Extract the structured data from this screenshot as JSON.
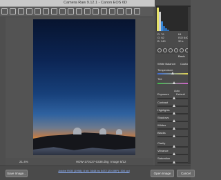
{
  "window": {
    "title": "Camera Raw 9.12.1  -  Canon EOS 6D"
  },
  "toolbar": {
    "tools": [
      "zoom-icon",
      "hand-icon",
      "white-balance-icon",
      "color-sampler-icon",
      "targeted-adjustment-icon",
      "crop-icon",
      "straighten-icon",
      "transform-icon",
      "spot-removal-icon",
      "red-eye-icon",
      "adjustment-brush-icon",
      "graduated-filter-icon",
      "radial-filter-icon",
      "preferences-icon",
      "rotate-left-icon",
      "rotate-right-icon",
      "delete-icon"
    ]
  },
  "status": {
    "zoom": "21.4%",
    "filename": "HDW-170127-0338.dng",
    "image_count": "Image 5/12"
  },
  "bottom": {
    "save_label": "Save Image...",
    "info_link": "Adobe RGB (1998); 8 bit; 3648 by 5472 (20.0MP); 300 ppi",
    "open_label": "Open Image",
    "cancel_label": "Cancel"
  },
  "panel": {
    "readout": {
      "r": "R:  76",
      "g": "G:  62",
      "b": "B:  149"
    },
    "exif": {
      "aperture": "f/4",
      "iso": "ISO 6400",
      "shutter": "30 s"
    },
    "section_title": "Basic",
    "white_balance_label": "White Balance:",
    "white_balance_value": "Custom",
    "auto_label": "Auto",
    "default_label": "Default",
    "sliders": {
      "temperature": "Temperature",
      "tint": "Tint",
      "exposure": "Exposure",
      "contrast": "Contrast",
      "highlights": "Highlights",
      "shadows": "Shadows",
      "whites": "Whites",
      "blacks": "Blacks",
      "clarity": "Clarity",
      "vibrance": "Vibrance",
      "saturation": "Saturation"
    }
  }
}
